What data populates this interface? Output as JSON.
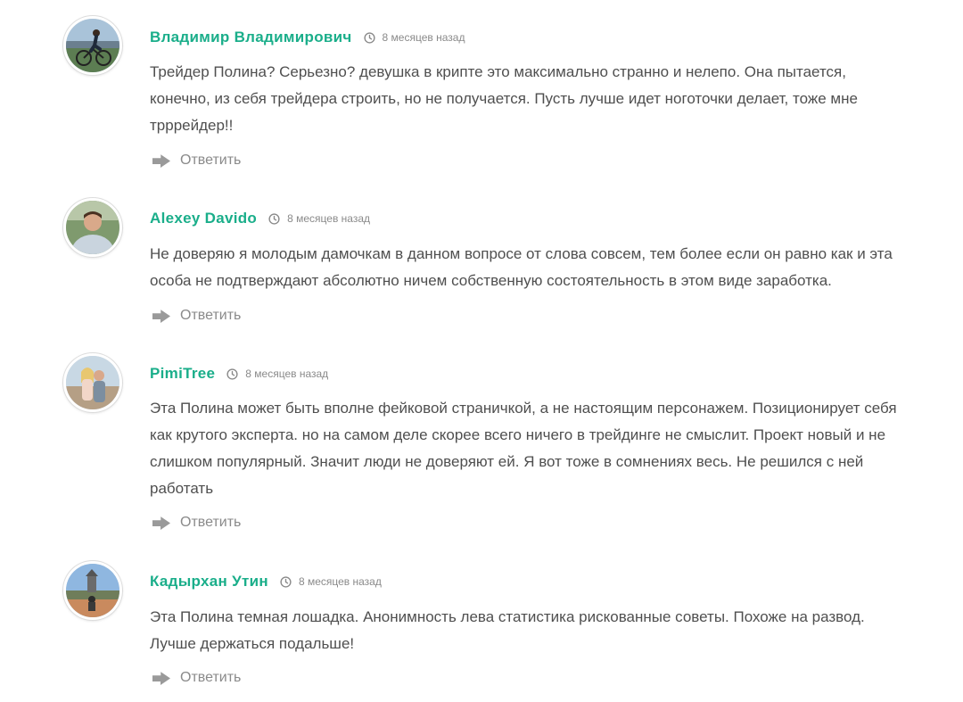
{
  "reply_label": "Ответить",
  "colors": {
    "author": "#1aae8a",
    "text": "#4f4f4f",
    "muted": "#8a8a8a"
  },
  "comments": [
    {
      "author": "Владимир Владимирович",
      "date": "8 месяцев назад",
      "text": "Трейдер Полина? Серьезно? девушка в крипте это максимально странно и нелепо. Она пытается, конечно, из себя трейдера строить, но не получается. Пусть лучше идет ноготочки делает, тоже мне трррейдер!!",
      "avatar_icon": "cyclist-photo-avatar"
    },
    {
      "author": "Alexey Davido",
      "date": "8 месяцев назад",
      "text": "Не доверяю я молодым дамочкам в данном вопросе от слова совсем, тем более если он равно как и эта особа не подтверждают абсолютно ничем собственную состоятельность в этом виде заработка.",
      "avatar_icon": "man-portrait-avatar"
    },
    {
      "author": "PimiTree",
      "date": "8 месяцев назад",
      "text": "Эта Полина может быть вполне фейковой страничкой, а не настоящим персонажем. Позиционирует себя как крутого эксперта. но на самом деле скорее всего ничего в трейдинге не смыслит. Проект новый и не слишком популярный. Значит люди не доверяют ей. Я вот тоже в сомнениях весь. Не решился с ней работать",
      "avatar_icon": "couple-photo-avatar"
    },
    {
      "author": "Кадырхан Утин",
      "date": "8 месяцев назад",
      "text": "Эта Полина темная лошадка. Анонимность лева статистика рискованные советы. Похоже на развод. Лучше держаться подальше!",
      "avatar_icon": "landscape-photo-avatar"
    }
  ]
}
